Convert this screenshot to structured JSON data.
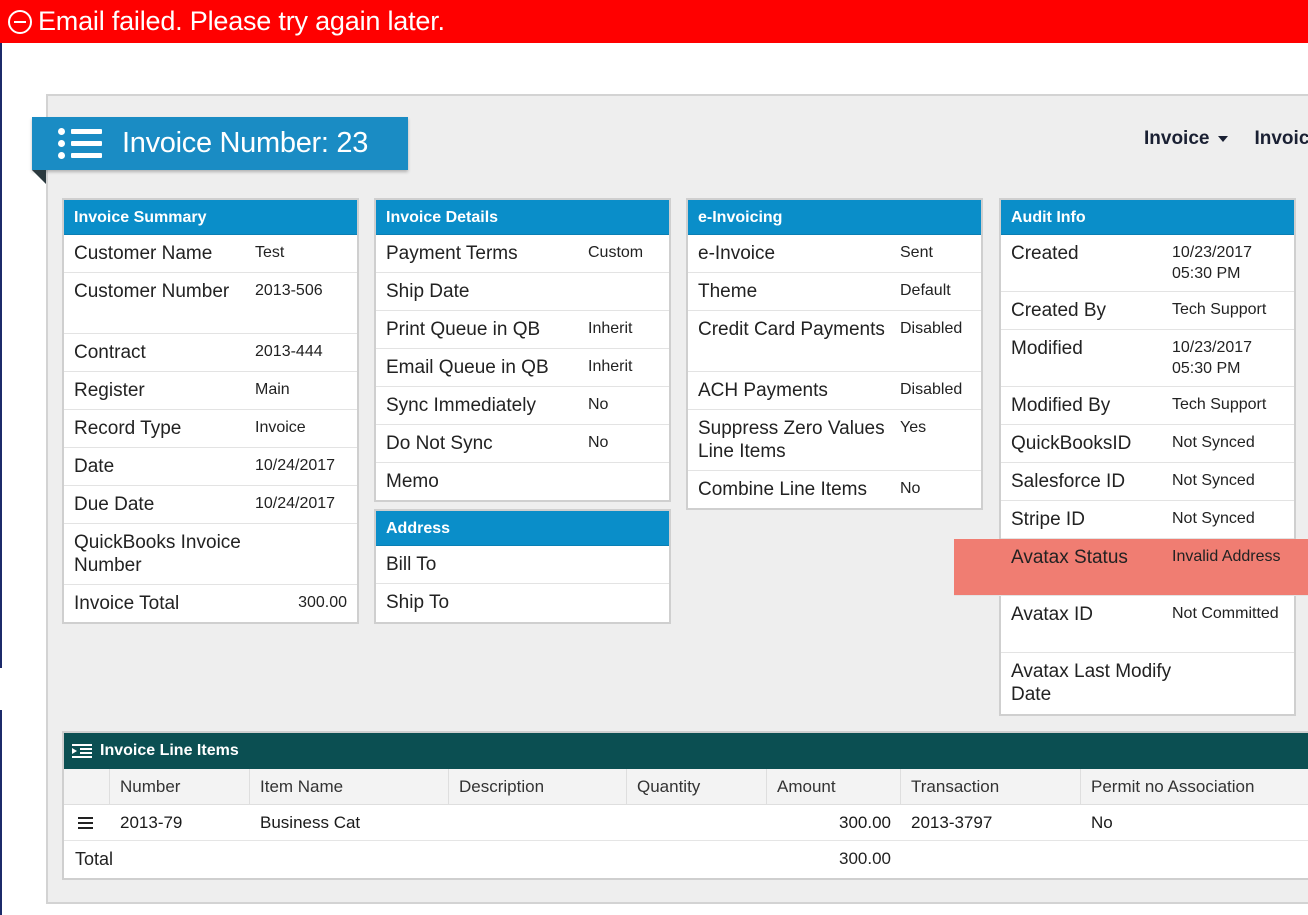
{
  "alert": {
    "message": "Email failed. Please try again later.",
    "color": "#ff0000"
  },
  "header": {
    "title": "Invoice Number: 23",
    "links": [
      "Invoice",
      "Invoic"
    ]
  },
  "summary": {
    "title": "Invoice Summary",
    "rows": [
      {
        "label": "Customer Name",
        "value": "Test"
      },
      {
        "label": "Customer Number",
        "value": "2013-506"
      },
      {
        "label": "Contract",
        "value": "2013-444"
      },
      {
        "label": "Register",
        "value": "Main"
      },
      {
        "label": "Record Type",
        "value": "Invoice"
      },
      {
        "label": "Date",
        "value": "10/24/2017"
      },
      {
        "label": "Due Date",
        "value": "10/24/2017"
      },
      {
        "label": "QuickBooks Invoice Number",
        "value": ""
      },
      {
        "label": "Invoice Total",
        "value": "300.00"
      }
    ]
  },
  "details": {
    "title": "Invoice Details",
    "rows": [
      {
        "label": "Payment Terms",
        "value": "Custom"
      },
      {
        "label": "Ship Date",
        "value": ""
      },
      {
        "label": "Print Queue in QB",
        "value": "Inherit"
      },
      {
        "label": "Email Queue in QB",
        "value": "Inherit"
      },
      {
        "label": "Sync Immediately",
        "value": "No"
      },
      {
        "label": "Do Not Sync",
        "value": "No"
      },
      {
        "label": "Memo",
        "value": ""
      }
    ]
  },
  "address": {
    "title": "Address",
    "rows": [
      {
        "label": "Bill To",
        "value": ""
      },
      {
        "label": "Ship To",
        "value": ""
      }
    ]
  },
  "einvoicing": {
    "title": "e-Invoicing",
    "rows": [
      {
        "label": "e-Invoice",
        "value": "Sent"
      },
      {
        "label": "Theme",
        "value": "Default"
      },
      {
        "label": "Credit Card Payments",
        "value": "Disabled"
      },
      {
        "label": "ACH Payments",
        "value": "Disabled"
      },
      {
        "label": "Suppress Zero Values Line Items",
        "value": "Yes"
      },
      {
        "label": "Combine Line Items",
        "value": "No"
      }
    ]
  },
  "audit": {
    "title": "Audit Info",
    "highlight_color": "#f07d72",
    "rows": [
      {
        "label": "Created",
        "value": "10/23/2017 05:30 PM"
      },
      {
        "label": "Created By",
        "value": "Tech Support"
      },
      {
        "label": "Modified",
        "value": "10/23/2017 05:30 PM"
      },
      {
        "label": "Modified By",
        "value": "Tech Support"
      },
      {
        "label": "QuickBooksID",
        "value": "Not Synced"
      },
      {
        "label": "Salesforce ID",
        "value": "Not Synced"
      },
      {
        "label": "Stripe ID",
        "value": "Not Synced"
      },
      {
        "label": "Avatax Status",
        "value": "Invalid Address"
      },
      {
        "label": "Avatax ID",
        "value": "Not Committed"
      },
      {
        "label": "Avatax Last Modify Date",
        "value": ""
      }
    ]
  },
  "line_items": {
    "title": "Invoice Line Items",
    "columns": [
      "Number",
      "Item Name",
      "Description",
      "Quantity",
      "Amount",
      "Transaction",
      "Permit no Association"
    ],
    "rows": [
      {
        "number": "2013-79",
        "item_name": "Business Cat",
        "description": "",
        "quantity": "",
        "amount": "300.00",
        "transaction": "2013-3797",
        "permit": "No"
      }
    ],
    "total_label": "Total",
    "total_amount": "300.00"
  }
}
